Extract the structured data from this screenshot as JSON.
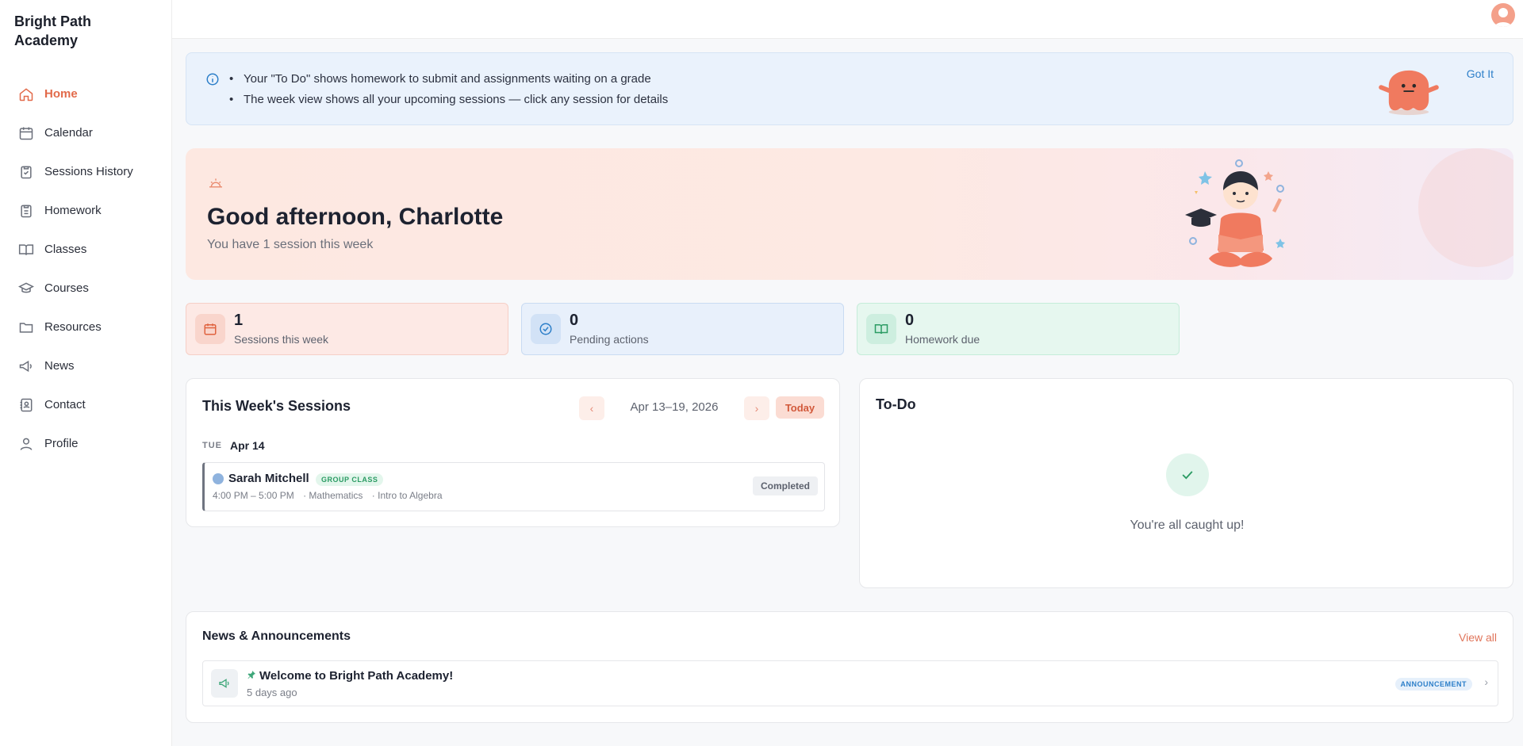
{
  "app": {
    "brand": "Bright Path Academy"
  },
  "sidebar": {
    "items": [
      {
        "label": "Home",
        "icon": "home-icon",
        "active": true
      },
      {
        "label": "Calendar",
        "icon": "calendar-icon"
      },
      {
        "label": "Sessions History",
        "icon": "clipboard-check-icon"
      },
      {
        "label": "Homework",
        "icon": "clipboard-icon"
      },
      {
        "label": "Classes",
        "icon": "book-open-icon"
      },
      {
        "label": "Courses",
        "icon": "graduation-cap-icon"
      },
      {
        "label": "Resources",
        "icon": "folder-icon"
      },
      {
        "label": "News",
        "icon": "megaphone-icon"
      },
      {
        "label": "Contact",
        "icon": "contact-book-icon"
      },
      {
        "label": "Profile",
        "icon": "user-icon"
      }
    ]
  },
  "info_banner": {
    "bullets": [
      "Your \"To Do\" shows homework to submit and assignments waiting on a grade",
      "The week view shows all your upcoming sessions — click any session for details"
    ],
    "dismiss_label": "Got It"
  },
  "hero": {
    "greeting": "Good afternoon, Charlotte",
    "subtitle": "You have 1 session this week"
  },
  "stats": [
    {
      "value": "1",
      "label": "Sessions this week",
      "icon": "calendar-icon"
    },
    {
      "value": "0",
      "label": "Pending actions",
      "icon": "check-circle-icon"
    },
    {
      "value": "0",
      "label": "Homework due",
      "icon": "book-icon"
    }
  ],
  "sessions_card": {
    "title": "This Week's Sessions",
    "date_range": "Apr 13–19, 2026",
    "today_label": "Today",
    "prev_glyph": "‹",
    "next_glyph": "›",
    "day": {
      "dow": "TUE",
      "date": "Apr 14"
    },
    "session": {
      "tutor": "Sarah Mitchell",
      "badge": "GROUP CLASS",
      "time": "4:00 PM – 5:00 PM",
      "subject": "· Mathematics",
      "topic": "· Intro to Algebra",
      "status": "Completed"
    }
  },
  "todo_card": {
    "title": "To-Do",
    "empty_text": "You're all caught up!"
  },
  "news_card": {
    "title": "News & Announcements",
    "view_all": "View all",
    "items": [
      {
        "title": "Welcome to Bright Path Academy!",
        "ago": "5 days ago",
        "tag": "ANNOUNCEMENT"
      }
    ]
  },
  "colors": {
    "accent": "#e26a4a",
    "link": "#2d7fc9",
    "success": "#2b9b63"
  }
}
